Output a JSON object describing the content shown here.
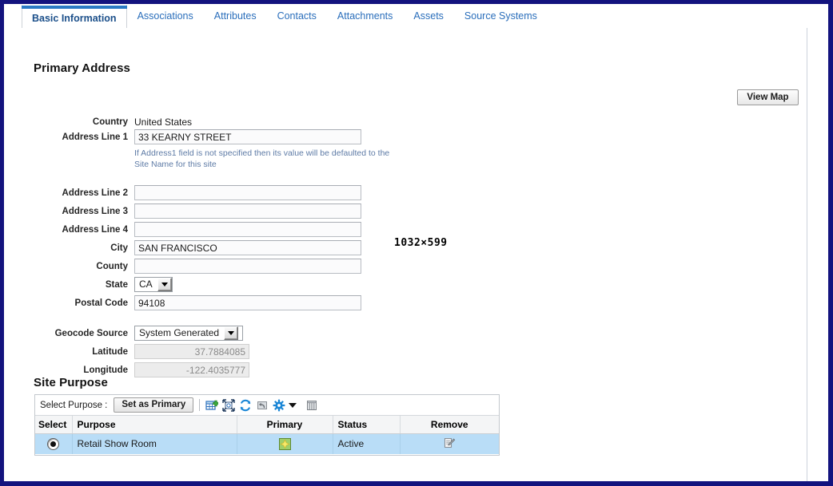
{
  "window": {
    "border_color": "#13137e",
    "dimension_label": "1032×599"
  },
  "tabs": [
    {
      "label": "Basic Information",
      "active": true
    },
    {
      "label": "Associations",
      "active": false
    },
    {
      "label": "Attributes",
      "active": false
    },
    {
      "label": "Contacts",
      "active": false
    },
    {
      "label": "Attachments",
      "active": false
    },
    {
      "label": "Assets",
      "active": false
    },
    {
      "label": "Source Systems",
      "active": false
    }
  ],
  "primary_address": {
    "title": "Primary Address",
    "view_map_label": "View Map",
    "country": {
      "label": "Country",
      "value": "United States"
    },
    "address_line_1": {
      "label": "Address Line 1",
      "value": "33 KEARNY STREET"
    },
    "address1_hint": "If Address1 field is not specified then its value will be defaulted to the Site Name for this site",
    "address_line_2": {
      "label": "Address Line 2",
      "value": ""
    },
    "address_line_3": {
      "label": "Address Line 3",
      "value": ""
    },
    "address_line_4": {
      "label": "Address Line 4",
      "value": ""
    },
    "city": {
      "label": "City",
      "value": "SAN FRANCISCO"
    },
    "county": {
      "label": "County",
      "value": ""
    },
    "state": {
      "label": "State",
      "value": "CA",
      "options": [
        "CA"
      ]
    },
    "postal_code": {
      "label": "Postal Code",
      "value": "94108"
    },
    "geocode_source": {
      "label": "Geocode Source",
      "value": "System Generated",
      "options": [
        "System Generated"
      ]
    },
    "latitude": {
      "label": "Latitude",
      "value": "37.7884085"
    },
    "longitude": {
      "label": "Longitude",
      "value": "-122.4035777"
    }
  },
  "site_purpose": {
    "title": "Site Purpose",
    "toolbar": {
      "select_purpose_label": "Select Purpose :",
      "set_primary_label": "Set as Primary",
      "icons": [
        "add-row-icon",
        "expand-icon",
        "refresh-icon",
        "undo-icon",
        "gear-icon",
        "caret-down-icon",
        "detach-columns-icon"
      ]
    },
    "columns": [
      "Select",
      "Purpose",
      "Primary",
      "Status",
      "Remove"
    ],
    "rows": [
      {
        "selected": true,
        "purpose": "Retail Show Room",
        "primary_icon": "primary-star-icon",
        "status": "Active",
        "remove_icon": "edit-remove-icon"
      }
    ]
  }
}
